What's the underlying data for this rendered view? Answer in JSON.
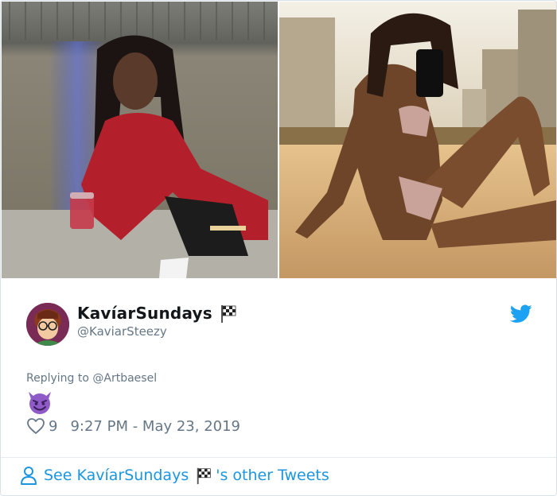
{
  "tweet": {
    "display_name": "KavíarSundays",
    "handle": "@KaviarSteezy",
    "replying_prefix": "Replying to",
    "replying_to": "@Artbaesel",
    "emoji_icon": "smiling-devil-icon",
    "like_count": "9",
    "timestamp": "9:27 PM - May 23, 2019"
  },
  "footer": {
    "see_prefix": "See KavíarSundays",
    "see_suffix": "'s other Tweets"
  },
  "colors": {
    "link": "#1b95e0",
    "secondary_text": "#657786",
    "primary_text": "#14171a",
    "divider": "#e6ecf0",
    "devil_purple": "#8e5bc7"
  },
  "icons": {
    "brand": "twitter-bird-icon",
    "flag": "checkered-flag-icon",
    "like": "heart-outline-icon",
    "profile": "person-outline-icon"
  }
}
